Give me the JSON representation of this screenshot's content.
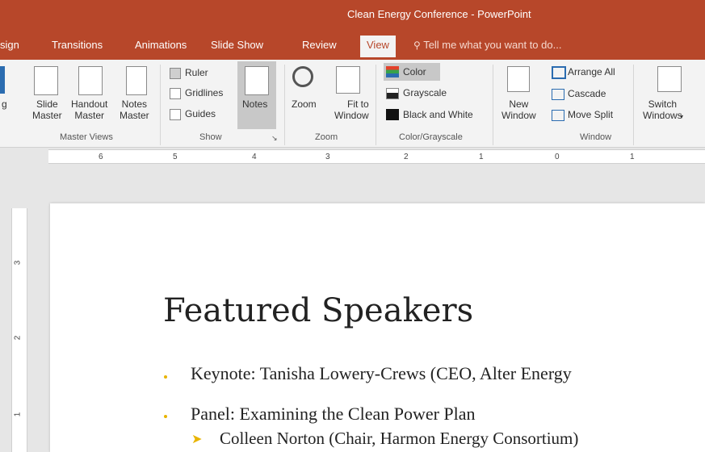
{
  "window": {
    "title": "Clean Energy Conference - PowerPoint"
  },
  "tabs": [
    {
      "label": "sign"
    },
    {
      "label": "Transitions"
    },
    {
      "label": "Animations"
    },
    {
      "label": "Slide Show"
    },
    {
      "label": "Review"
    },
    {
      "label": "View"
    }
  ],
  "tell_me": "Tell me what you want to do...",
  "ribbon": {
    "master_views": {
      "label": "Master Views",
      "slide_master": "Slide\nMaster",
      "handout_master": "Handout\nMaster",
      "notes_master": "Notes\nMaster",
      "partial": "g"
    },
    "show": {
      "label": "Show",
      "ruler": "Ruler",
      "gridlines": "Gridlines",
      "guides": "Guides",
      "notes": "Notes"
    },
    "zoom": {
      "label": "Zoom",
      "zoom": "Zoom",
      "fit_to_window": "Fit to\nWindow"
    },
    "color": {
      "label": "Color/Grayscale",
      "color": "Color",
      "grayscale": "Grayscale",
      "black_white": "Black and White"
    },
    "window": {
      "label": "Window",
      "new_window": "New\nWindow",
      "arrange_all": "Arrange All",
      "cascade": "Cascade",
      "move_split": "Move Split",
      "switch_windows": "Switch\nWindows"
    }
  },
  "ruler": {
    "h_numbers": [
      "6",
      "5",
      "4",
      "3",
      "2",
      "1",
      "0",
      "1"
    ],
    "v_numbers": [
      "3",
      "2",
      "1"
    ]
  },
  "slide": {
    "title": "Featured Speakers",
    "bullets": [
      "Keynote: Tanisha Lowery-Crews (CEO, Alter Energy",
      "Panel: Examining the Clean Power Plan"
    ],
    "sub_bullets": [
      "Colleen Norton (Chair, Harmon Energy Consortium)"
    ]
  }
}
